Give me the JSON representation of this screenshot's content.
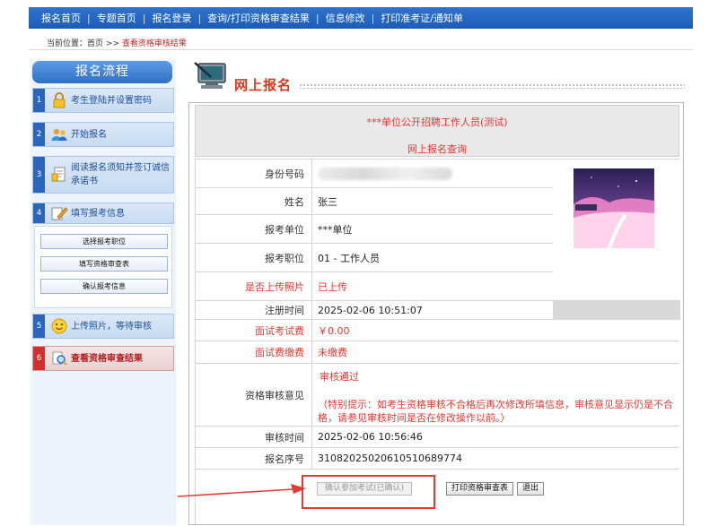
{
  "nav": {
    "items": [
      "报名首页",
      "专题首页",
      "报名登录",
      "查询/打印资格审查结果",
      "信息修改",
      "打印准考证/通知单"
    ],
    "separator": "|"
  },
  "breadcrumb": {
    "prefix": "当前位置：",
    "home": "首页",
    "sep": ">>",
    "current": "查看资格审核结果"
  },
  "sidebar": {
    "title": "报名流程",
    "steps": [
      {
        "num": "1",
        "label": "考生登陆并设置密码",
        "icon": "lock-icon"
      },
      {
        "num": "2",
        "label": "开始报名",
        "icon": "users-icon"
      },
      {
        "num": "3",
        "label": "阅读报名须知并签订诚信承诺书",
        "icon": "document-icon"
      },
      {
        "num": "4",
        "label": "填写报考信息",
        "icon": "pencil-icon"
      },
      {
        "num": "5",
        "label": "上传照片，等待审核",
        "icon": "smiley-icon"
      },
      {
        "num": "6",
        "label": "查看资格审查结果",
        "icon": "magnifier-icon"
      }
    ],
    "sub_buttons": [
      "选择报考职位",
      "填写资格审查表",
      "确认报考信息"
    ]
  },
  "main": {
    "title": "网上报名",
    "banner_line1": "***单位公开招聘工作人员(测试)",
    "banner_line2": "网上报名查询"
  },
  "fields": {
    "id_label": "身份号码",
    "name_label": "姓名",
    "name_value": "张三",
    "unit_label": "报考单位",
    "unit_value": "***单位",
    "post_label": "报考职位",
    "post_value": "01 - 工作人员",
    "photo_label": "是否上传照片",
    "photo_value": "已上传",
    "reg_time_label": "注册时间",
    "reg_time_value": "2025-02-06 10:51:07",
    "exam_fee_label": "面试考试费",
    "exam_fee_value": "￥0.00",
    "fee_paid_label": "面试费缴费",
    "fee_paid_value": "未缴费",
    "audit_label": "资格审核意见",
    "audit_value": "审核通过",
    "audit_note": "（特别提示：如考生资格审核不合格后再次修改所填信息，审核意见显示仍是不合格，请参见审核时间是否在修改操作以前。）",
    "audit_time_label": "审核时间",
    "audit_time_value": "2025-02-06 10:56:46",
    "serial_label": "报名序号",
    "serial_value": "310820250206105106897​74"
  },
  "buttons": {
    "confirm": "确认参加考试(已确认)",
    "print": "打印资格审查表",
    "exit": "退出"
  },
  "colors": {
    "nav_blue": "#1c5bb5",
    "title_red": "#d43a1f",
    "alert_red": "#e53935",
    "highlight_red": "#e53935"
  }
}
